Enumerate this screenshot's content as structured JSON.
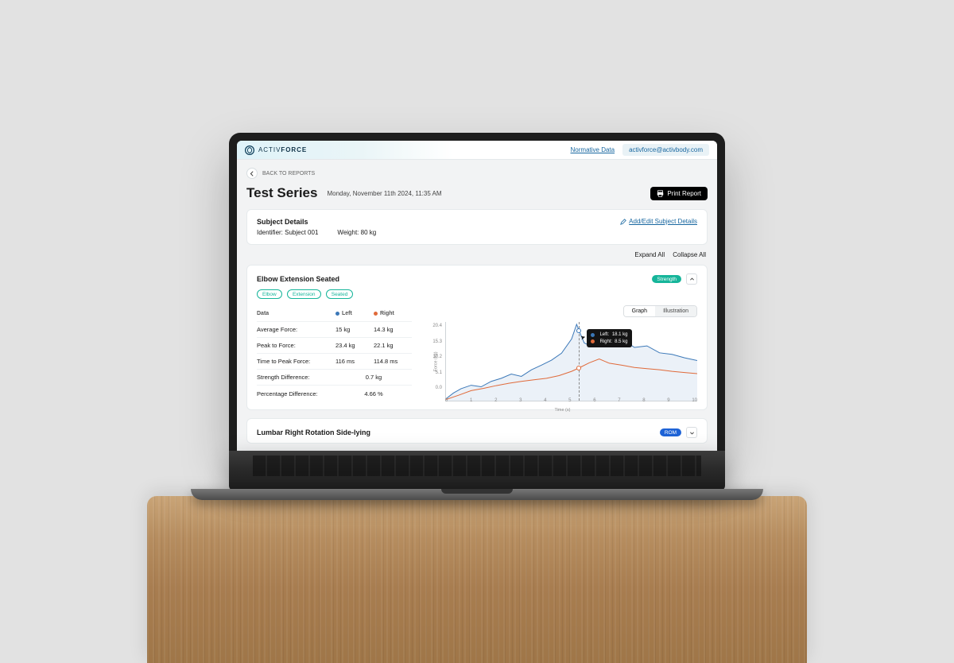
{
  "brand": {
    "prefix": "ACTIV",
    "suffix": "FORCE"
  },
  "top_links": {
    "normative": "Normative Data",
    "user": "activforce@activbody.com"
  },
  "back": {
    "label": "BACK TO REPORTS"
  },
  "page_title": "Test Series",
  "page_datetime": "Monday, November 11th 2024, 11:35 AM",
  "print_label": "Print Report",
  "subject": {
    "heading": "Subject Details",
    "identifier_label": "Identifier:",
    "identifier_value": "Subject 001",
    "weight_label": "Weight:",
    "weight_value": "80 kg",
    "edit_label": "Add/Edit Subject Details"
  },
  "list_controls": {
    "expand": "Expand All",
    "collapse": "Collapse All"
  },
  "panel1": {
    "title": "Elbow Extension Seated",
    "tags": [
      "Elbow",
      "Extension",
      "Seated"
    ],
    "badge": "Strength",
    "segmented": {
      "graph": "Graph",
      "illustration": "Illustration",
      "active": "graph"
    },
    "table": {
      "col_data": "Data",
      "col_left": "Left",
      "col_right": "Right",
      "rows": [
        {
          "label": "Average Force:",
          "left": "15 kg",
          "right": "14.3 kg"
        },
        {
          "label": "Peak to Force:",
          "left": "23.4 kg",
          "right": "22.1 kg"
        },
        {
          "label": "Time to Peak Force:",
          "left": "116 ms",
          "right": "114.8 ms"
        }
      ],
      "summary": [
        {
          "label": "Strength Difference:",
          "value": "0.7 kg"
        },
        {
          "label": "Percentage Difference:",
          "value": "4.66 %"
        }
      ]
    },
    "tooltip": {
      "left_label": "Left:",
      "left_value": "18.1 kg",
      "right_label": "Right:",
      "right_value": "8.5 kg"
    }
  },
  "panel2": {
    "title": "Lumbar Right Rotation Side-lying",
    "badge": "ROM"
  },
  "chart_data": {
    "type": "line",
    "title": "",
    "xlabel": "Time (s)",
    "ylabel": "Force (kg)",
    "xlim": [
      0,
      10
    ],
    "ylim": [
      0,
      20.4
    ],
    "x_ticks": [
      0,
      1,
      2,
      3,
      4,
      5,
      6,
      7,
      8,
      9,
      10
    ],
    "y_ticks": [
      0.0,
      5.1,
      10.2,
      15.3,
      20.4
    ],
    "cursor_x": 5.3,
    "series": [
      {
        "name": "Left",
        "color": "#3b78b8",
        "x": [
          0,
          0.3,
          0.6,
          1,
          1.4,
          1.8,
          2.2,
          2.6,
          3,
          3.4,
          3.8,
          4.2,
          4.6,
          5,
          5.2,
          5.3,
          5.5,
          5.8,
          6.1,
          6.5,
          7,
          7.5,
          8,
          8.5,
          9,
          9.5,
          10
        ],
        "y": [
          0.5,
          2.0,
          3.1,
          4.0,
          3.6,
          5.0,
          5.8,
          6.9,
          6.3,
          8.0,
          9.2,
          10.5,
          12.3,
          16.0,
          19.8,
          18.1,
          15.0,
          14.0,
          14.8,
          17.3,
          16.0,
          13.8,
          14.2,
          12.4,
          12.0,
          11.1,
          10.4
        ]
      },
      {
        "name": "Right",
        "color": "#e06a3a",
        "x": [
          0,
          0.5,
          1,
          1.5,
          2,
          2.5,
          3,
          3.5,
          4,
          4.5,
          5,
          5.3,
          5.7,
          6.1,
          6.5,
          7,
          7.5,
          8,
          8.5,
          9,
          9.5,
          10
        ],
        "y": [
          0.3,
          1.4,
          2.6,
          3.2,
          3.9,
          4.5,
          5.0,
          5.4,
          5.8,
          6.5,
          7.6,
          8.5,
          9.8,
          10.8,
          9.7,
          9.2,
          8.6,
          8.3,
          8.0,
          7.6,
          7.3,
          7.0
        ]
      }
    ]
  }
}
